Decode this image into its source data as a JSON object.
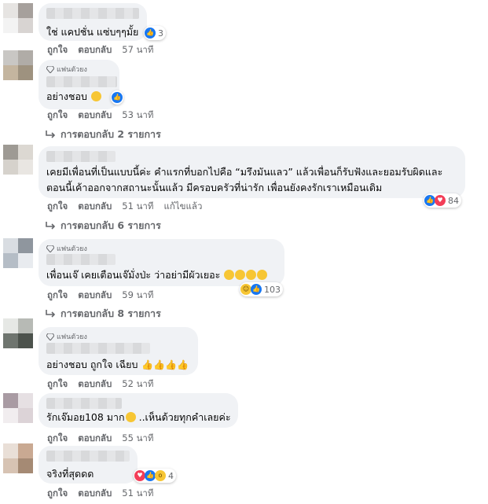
{
  "badge_label": "แฟนตัวยง",
  "comments": [
    {
      "id": "c1",
      "has_badge": false,
      "text": "ใช่ แคปชั่น แซ่บๆๆมั้ย",
      "reaction_count": "3",
      "reactions": [
        "like"
      ],
      "actions": {
        "like": "ถูกใจ",
        "reply": "ตอบกลับ",
        "time": "57 นาที"
      }
    },
    {
      "id": "c2",
      "has_badge": true,
      "text": "อย่างชอบ",
      "reaction_count": "",
      "reactions": [
        "like"
      ],
      "actions": {
        "like": "ถูกใจ",
        "reply": "ตอบกลับ",
        "time": "53 นาที"
      },
      "replies_label": "การตอบกลับ 2 รายการ"
    },
    {
      "id": "c3",
      "has_badge": false,
      "text_lines": [
        "เคยมีเพื่อนที่เป็นแบบนี้ค่ะ คำแรกที่บอกไปคือ “มรึงมันแลว” แล้วเพื่อนก็รับฟังและยอมรับผิดและ",
        "ตอนนี้เค้าออกจากสถานะนั้นแล้ว มีครอบครัวที่น่ารัก เพื่อนยังคงรักเราเหมือนเดิม"
      ],
      "reaction_count": "84",
      "reactions": [
        "like",
        "love"
      ],
      "actions": {
        "like": "ถูกใจ",
        "reply": "ตอบกลับ",
        "time": "51 นาที",
        "edited": "แก้ไขแล้ว"
      },
      "replies_label": "การตอบกลับ 6 รายการ"
    },
    {
      "id": "c4",
      "has_badge": true,
      "text": "เพื่อนเจ๊ เคยเตือนเจ๊มั่งป่ะ ว่าอย่ามีผัวเยอะ",
      "reaction_count": "103",
      "reactions": [
        "haha",
        "like"
      ],
      "actions": {
        "like": "ถูกใจ",
        "reply": "ตอบกลับ",
        "time": "59 นาที"
      },
      "replies_label": "การตอบกลับ 8 รายการ"
    },
    {
      "id": "c5",
      "has_badge": true,
      "text": "อย่างชอบ ถูกใจ เฉียบ",
      "reaction_count": "",
      "reactions": [],
      "actions": {
        "like": "ถูกใจ",
        "reply": "ตอบกลับ",
        "time": "52 นาที"
      }
    },
    {
      "id": "c6",
      "has_badge": false,
      "text": "รักเจ๊มอย108 มาก",
      "text_after": "..เห็นด้วยทุกคำเลยค่ะ",
      "reaction_count": "",
      "reactions": [],
      "actions": {
        "like": "ถูกใจ",
        "reply": "ตอบกลับ",
        "time": "55 นาที"
      }
    },
    {
      "id": "c7",
      "has_badge": false,
      "text": "จริงที่สุดดด",
      "reaction_count": "4",
      "reactions": [
        "love",
        "like",
        "wow"
      ],
      "actions": {
        "like": "ถูกใจ",
        "reply": "ตอบกลับ",
        "time": "51 นาที"
      }
    }
  ],
  "colors": {
    "bubble": "#f0f2f5",
    "meta_text": "#65676b",
    "like_blue": "#1877f2",
    "love_red": "#f33e58",
    "emoji_yellow": "#f7c634"
  }
}
